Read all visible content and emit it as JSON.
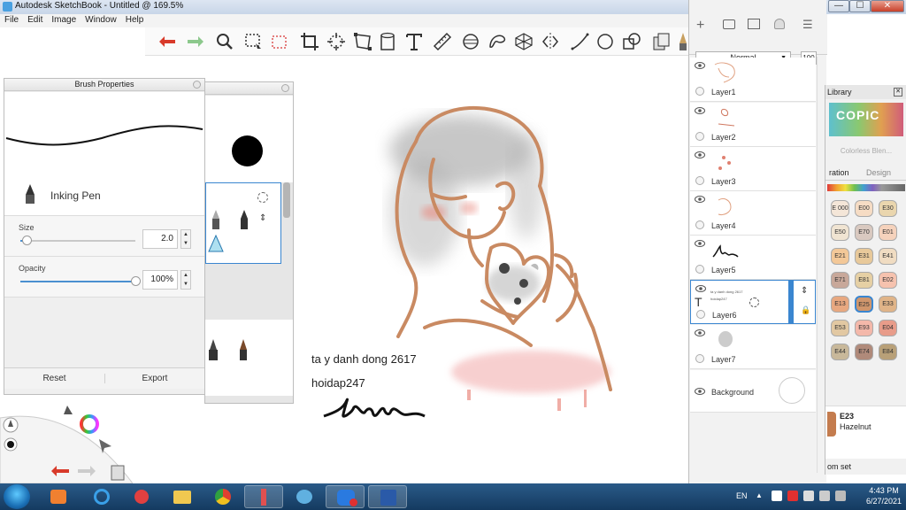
{
  "window": {
    "title": "Autodesk SketchBook - Untitled @ 169.5%",
    "minimize": "—",
    "maximize": "☐",
    "close": "✕"
  },
  "menu": [
    "File",
    "Edit",
    "Image",
    "Window",
    "Help"
  ],
  "brush_properties": {
    "title": "Brush Properties",
    "brush_name": "Inking Pen",
    "size_label": "Size",
    "size_value": "2.0",
    "size_fraction": 0.05,
    "opacity_label": "Opacity",
    "opacity_value": "100%",
    "opacity_fraction": 1.0,
    "reset": "Reset",
    "export": "Export"
  },
  "layers": {
    "blend_mode": "Normal",
    "opacity": "100",
    "items": [
      {
        "name": "Layer1"
      },
      {
        "name": "Layer2"
      },
      {
        "name": "Layer3"
      },
      {
        "name": "Layer4"
      },
      {
        "name": "Layer5"
      },
      {
        "name": "Layer6",
        "selected": true,
        "thumb_text_1": "ta y danh dong 2617",
        "thumb_text_2": "hoidap247"
      },
      {
        "name": "Layer7"
      },
      {
        "name": "Background"
      }
    ]
  },
  "copic": {
    "title": "Library",
    "logo": "COPIC",
    "blender": "Colorless Blen...",
    "tab_1": "ration",
    "tab_2": "Design",
    "swatches": [
      {
        "code": "E 000",
        "color": "#f4e6d8"
      },
      {
        "code": "E00",
        "color": "#f6dcc4"
      },
      {
        "code": "E30",
        "color": "#ead6ae"
      },
      {
        "code": "E50",
        "color": "#f0e4d2"
      },
      {
        "code": "E70",
        "color": "#d9c9c0"
      },
      {
        "code": "E01",
        "color": "#f5d2bc"
      },
      {
        "code": "E21",
        "color": "#f3c898"
      },
      {
        "code": "E31",
        "color": "#e8c99a"
      },
      {
        "code": "E41",
        "color": "#f0dcc2"
      },
      {
        "code": "E71",
        "color": "#c8a89a"
      },
      {
        "code": "E81",
        "color": "#e6d0a4"
      },
      {
        "code": "E02",
        "color": "#f6c2ae"
      },
      {
        "code": "E13",
        "color": "#e8a880"
      },
      {
        "code": "E25",
        "color": "#d0966c",
        "selected": true
      },
      {
        "code": "E33",
        "color": "#e0b488"
      },
      {
        "code": "E53",
        "color": "#e2c8a2"
      },
      {
        "code": "E93",
        "color": "#f4b8aa"
      },
      {
        "code": "E04",
        "color": "#e89c8a"
      },
      {
        "code": "E44",
        "color": "#c8b89a"
      },
      {
        "code": "E74",
        "color": "#b08a7a"
      },
      {
        "code": "E84",
        "color": "#b8a078"
      }
    ],
    "current_code": "E23",
    "current_name": "Hazelnut",
    "set_label": "om set"
  },
  "canvas": {
    "text_1": "ta y danh dong 2617",
    "text_2": "hoidap247"
  },
  "taskbar": {
    "language": "EN",
    "time": "4:43 PM",
    "date": "6/27/2021"
  },
  "colors": {
    "accent": "#3a86d0",
    "line_art": "#c98a62",
    "shadow": "#9a9a9a",
    "blush": "#e98a80"
  }
}
